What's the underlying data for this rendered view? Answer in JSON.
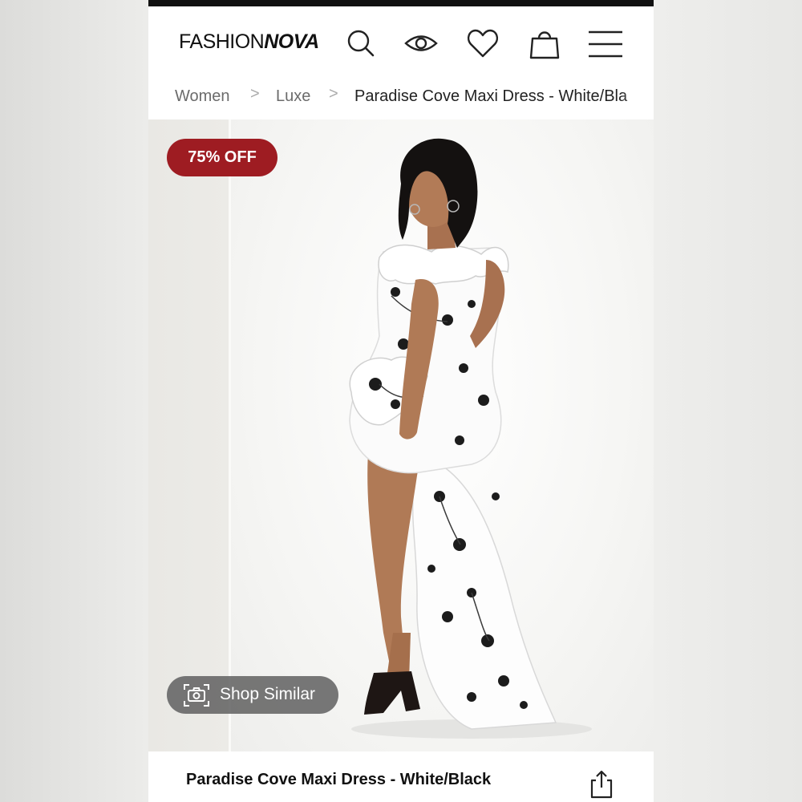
{
  "brand": {
    "logo_light": "FASHION",
    "logo_bold": "NOVA"
  },
  "header": {
    "icons": [
      "search-icon",
      "eye-icon",
      "heart-icon",
      "shopping-bag-icon",
      "hamburger-menu-icon"
    ]
  },
  "breadcrumb": {
    "items": [
      "Women",
      "Luxe",
      "Paradise Cove Maxi Dress - White/Bla"
    ],
    "separator": ">"
  },
  "gallery": {
    "badge": "75% OFF",
    "shop_similar": "Shop Similar"
  },
  "product": {
    "title": "Paradise Cove Maxi Dress - White/Black"
  },
  "colors": {
    "badge_bg": "#9e1c22",
    "shop_similar_bg": "#5a5a5a",
    "text": "#111111"
  }
}
